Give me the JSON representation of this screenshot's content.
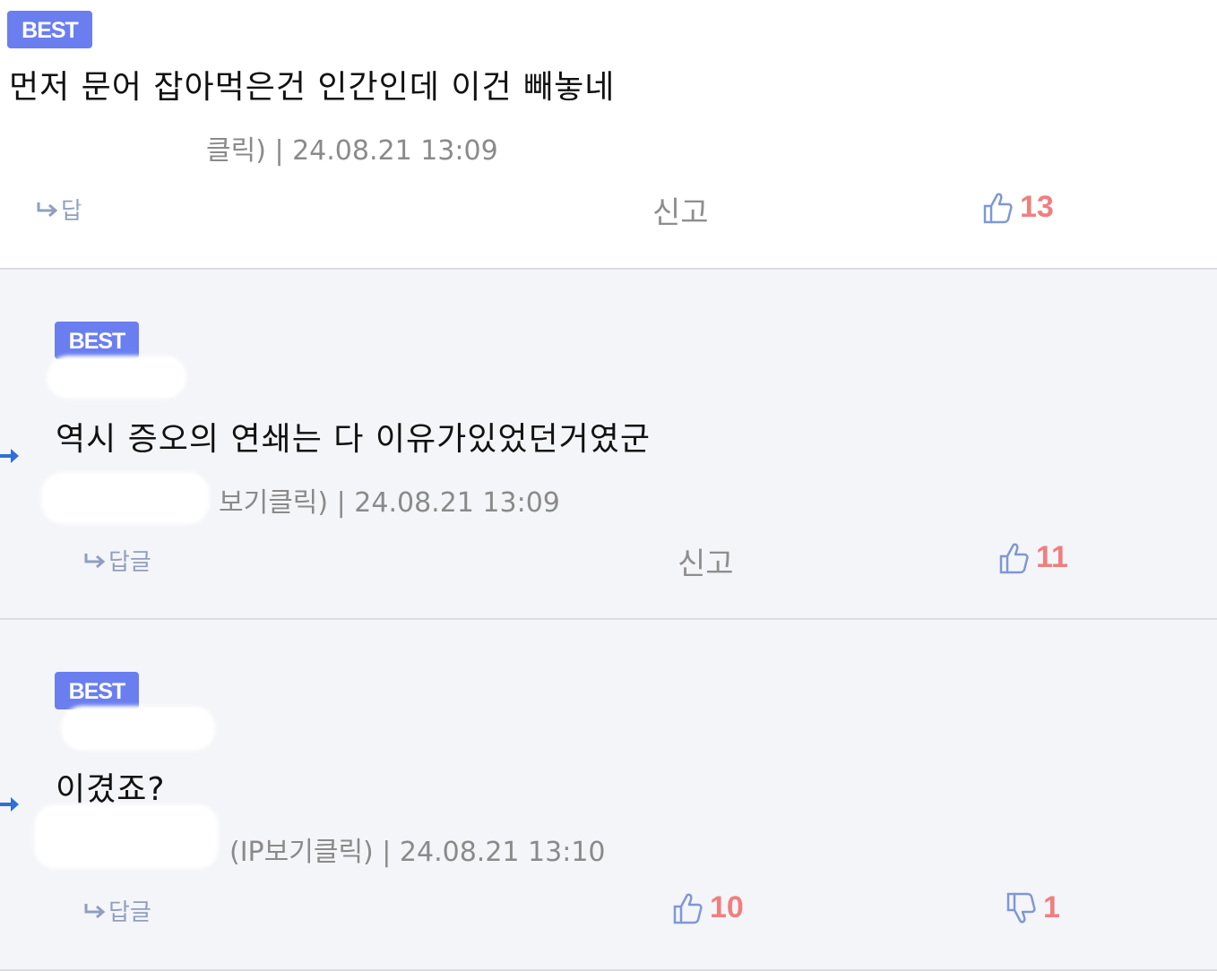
{
  "comments": [
    {
      "badge": "BEST",
      "text": "먼저 문어 잡아먹은건 인간인데 이건 빼놓네",
      "meta": "클릭) | 24.08.21 13:09",
      "reply_label": "답",
      "report_label": "신고",
      "upvotes": "13"
    },
    {
      "badge": "BEST",
      "text": "역시 증오의 연쇄는 다 이유가있었던거였군",
      "meta": "보기클릭) | 24.08.21 13:09",
      "reply_label": "답글",
      "report_label": "신고",
      "upvotes": "11"
    },
    {
      "badge": "BEST",
      "text": "이겼죠?",
      "meta": "(IP보기클릭) | 24.08.21 13:10",
      "reply_label": "답글",
      "upvotes": "10",
      "downvotes": "1"
    }
  ],
  "icons": {
    "reply": "reply-arrow-icon",
    "like": "thumbs-up-icon",
    "dislike": "thumbs-down-icon",
    "nested": "nested-reply-arrow-icon"
  },
  "colors": {
    "badge": "#6b7ef0",
    "vote_count": "#ef7f7f",
    "icon_blue": "#7f97d6",
    "nested_arrow": "#2f6fd6"
  }
}
